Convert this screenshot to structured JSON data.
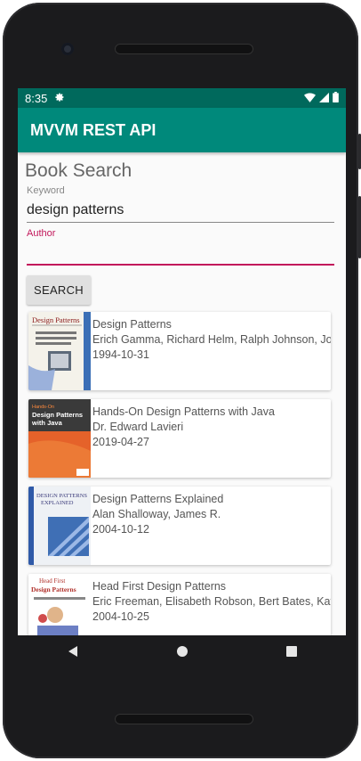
{
  "status_bar": {
    "time": "8:35"
  },
  "app_bar": {
    "title": "MVVM REST API"
  },
  "form": {
    "heading": "Book Search",
    "keyword": {
      "label": "Keyword",
      "value": "design patterns"
    },
    "author": {
      "label": "Author",
      "value": ""
    },
    "search_button": "SEARCH"
  },
  "books": [
    {
      "title": "Design Patterns",
      "authors": "Erich Gamma, Richard Helm, Ralph Johnson, John Vlissides",
      "date": "1994-10-31",
      "cover_title": "Design Patterns",
      "cover_sub": "Elements of Reusable Object-Oriented Software"
    },
    {
      "title": "Hands-On Design Patterns with Java",
      "authors": "Dr. Edward Lavieri",
      "date": "2019-04-27",
      "cover_tag": "Hands-On",
      "cover_title": "Design Patterns with Java"
    },
    {
      "title": "Design Patterns Explained",
      "authors": "Alan Shalloway, James R.",
      "date": "2004-10-12",
      "cover_title": "Design Patterns Explained"
    },
    {
      "title": "Head First Design Patterns",
      "authors": "Eric Freeman, Elisabeth Robson, Bert Bates, Kathy Sierra",
      "date": "2004-10-25",
      "cover_tag": "Head First",
      "cover_title": "Design Patterns"
    }
  ],
  "colors": {
    "status_bar": "#00695c",
    "app_bar": "#00897b",
    "accent": "#c2185b"
  }
}
